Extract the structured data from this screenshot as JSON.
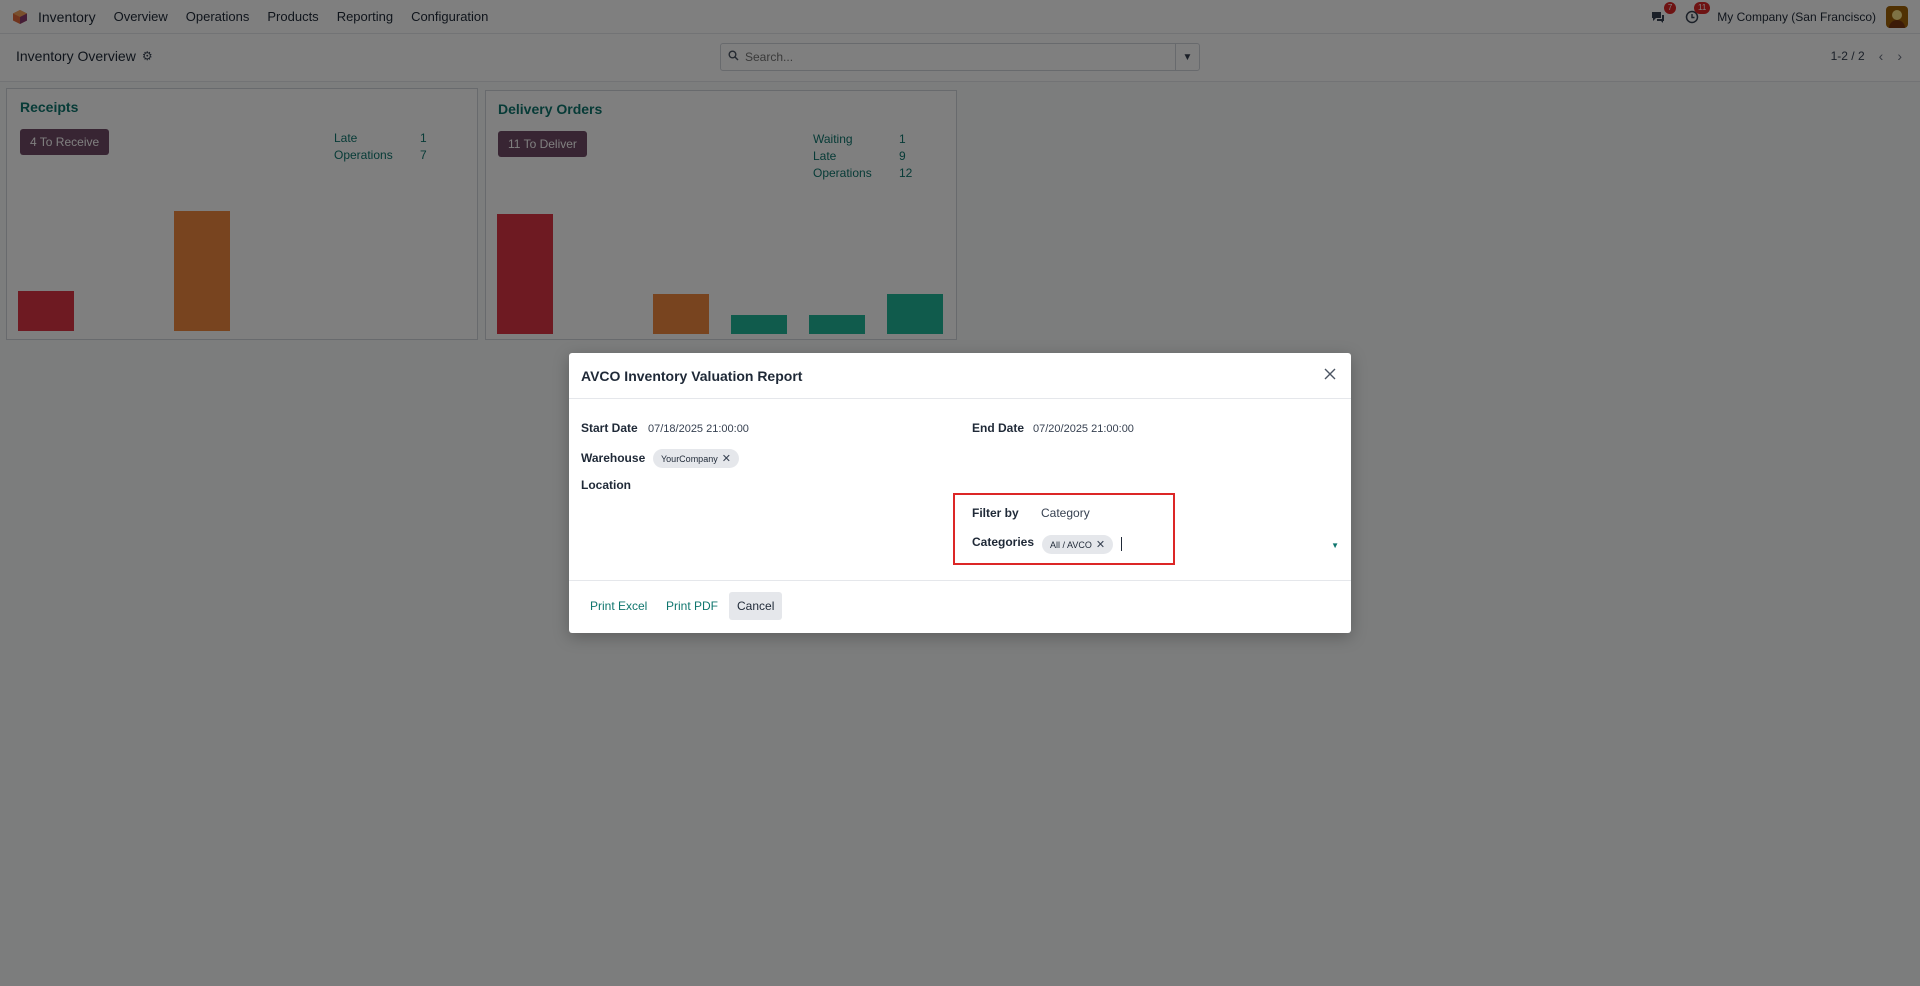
{
  "nav": {
    "app_name": "Inventory",
    "items": [
      "Overview",
      "Operations",
      "Products",
      "Reporting",
      "Configuration"
    ],
    "messages_badge": "7",
    "activities_badge": "11",
    "company": "My Company (San Francisco)"
  },
  "control": {
    "title": "Inventory Overview",
    "search_placeholder": "Search...",
    "pager": "1-2 / 2"
  },
  "receipts": {
    "title": "Receipts",
    "button": "4 To Receive",
    "stats": [
      {
        "label": "Late",
        "value": "1"
      },
      {
        "label": "Operations",
        "value": "7"
      }
    ],
    "bars": [
      {
        "color": "#dc3545",
        "level": 0.33
      },
      {
        "color": "#f0883e",
        "level": 1.0
      }
    ]
  },
  "delivery": {
    "title": "Delivery Orders",
    "button": "11 To Deliver",
    "stats": [
      {
        "label": "Waiting",
        "value": "1"
      },
      {
        "label": "Late",
        "value": "9"
      },
      {
        "label": "Operations",
        "value": "12"
      }
    ],
    "bars": [
      {
        "color": "#dc3545",
        "level": 1.0
      },
      {
        "color": "#f0883e",
        "level": 0.33
      },
      {
        "color": "#21b799",
        "level": 0.16
      },
      {
        "color": "#21b799",
        "level": 0.16
      },
      {
        "color": "#21b799",
        "level": 0.33
      }
    ]
  },
  "modal": {
    "title": "AVCO Inventory Valuation Report",
    "start_date_label": "Start Date",
    "start_date": "07/18/2025 21:00:00",
    "end_date_label": "End Date",
    "end_date": "07/20/2025 21:00:00",
    "warehouse_label": "Warehouse",
    "warehouse_tag": "YourCompany",
    "location_label": "Location",
    "filter_label": "Filter by",
    "filter_value": "Category",
    "categories_label": "Categories",
    "category_tag": "All / AVCO",
    "print_excel": "Print Excel",
    "print_pdf": "Print PDF",
    "cancel": "Cancel"
  }
}
